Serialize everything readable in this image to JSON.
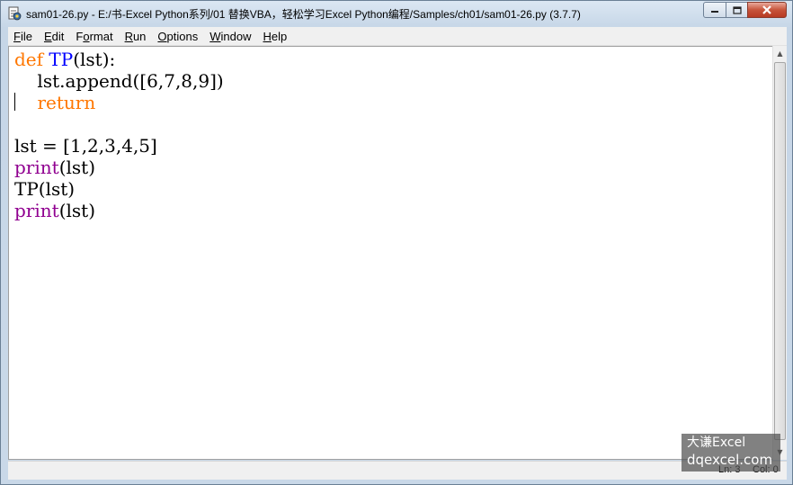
{
  "window": {
    "title": "sam01-26.py - E:/书-Excel Python系列/01 替换VBA，轻松学习Excel Python编程/Samples/ch01/sam01-26.py (3.7.7)"
  },
  "menu": {
    "items": [
      {
        "mnemonic": "F",
        "rest": "ile"
      },
      {
        "mnemonic": "E",
        "rest": "dit"
      },
      {
        "pre": "F",
        "mnemonic": "o",
        "rest": "rmat"
      },
      {
        "mnemonic": "R",
        "rest": "un"
      },
      {
        "mnemonic": "O",
        "rest": "ptions"
      },
      {
        "mnemonic": "W",
        "rest": "indow"
      },
      {
        "mnemonic": "H",
        "rest": "elp"
      }
    ]
  },
  "editor": {
    "lines": {
      "l1_kw": "def",
      "l1_name": "TP",
      "l1_rest": "(lst):",
      "l2": "    lst.append([6,7,8,9])",
      "l3_kw": "return",
      "l5": "lst = [1,2,3,4,5]",
      "l6_fn": "print",
      "l6_rest": "(lst)",
      "l7": "TP(lst)",
      "l8_fn": "print",
      "l8_rest": "(lst)"
    }
  },
  "status": {
    "line": "Ln: 3",
    "col": "Col: 0"
  },
  "watermark": {
    "line1": "大谦Excel",
    "line2": "dqexcel.com"
  },
  "icons": {
    "app": "python-idle-icon",
    "minimize": "minimize-icon",
    "maximize": "maximize-icon",
    "close": "close-icon"
  }
}
